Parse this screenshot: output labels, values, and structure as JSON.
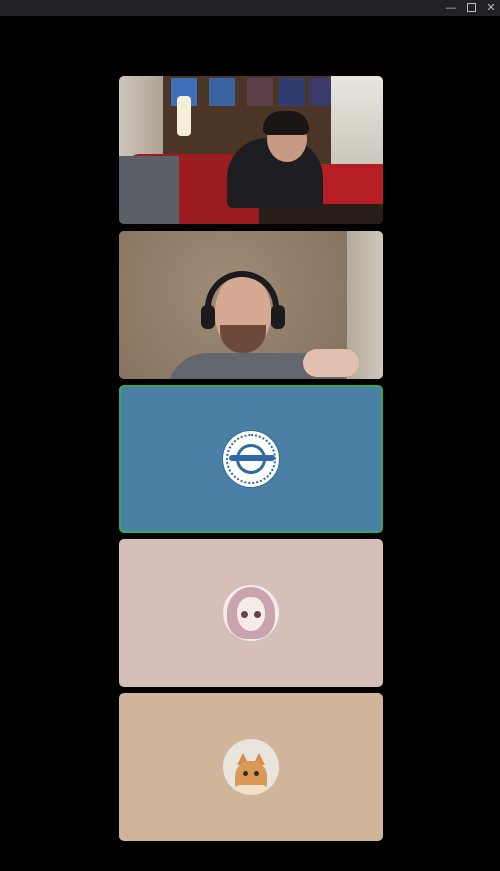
{
  "window": {
    "controls": {
      "minimize_icon": "minimize-icon",
      "maximize_icon": "maximize-icon",
      "close_icon": "close-icon",
      "minimize_glyph": "—",
      "close_glyph": "✕"
    }
  },
  "participants": [
    {
      "type": "video",
      "speaking": false
    },
    {
      "type": "video",
      "speaking": false
    },
    {
      "type": "avatar",
      "avatar": "laughing-man-avatar",
      "background": "#4b80a6",
      "speaking": true,
      "speaking_color": "#3ba55d"
    },
    {
      "type": "avatar",
      "avatar": "anime-girl-avatar",
      "background": "#d7bfb9",
      "speaking": false
    },
    {
      "type": "avatar",
      "avatar": "cat-avatar",
      "background": "#d0b59a",
      "speaking": false
    }
  ]
}
